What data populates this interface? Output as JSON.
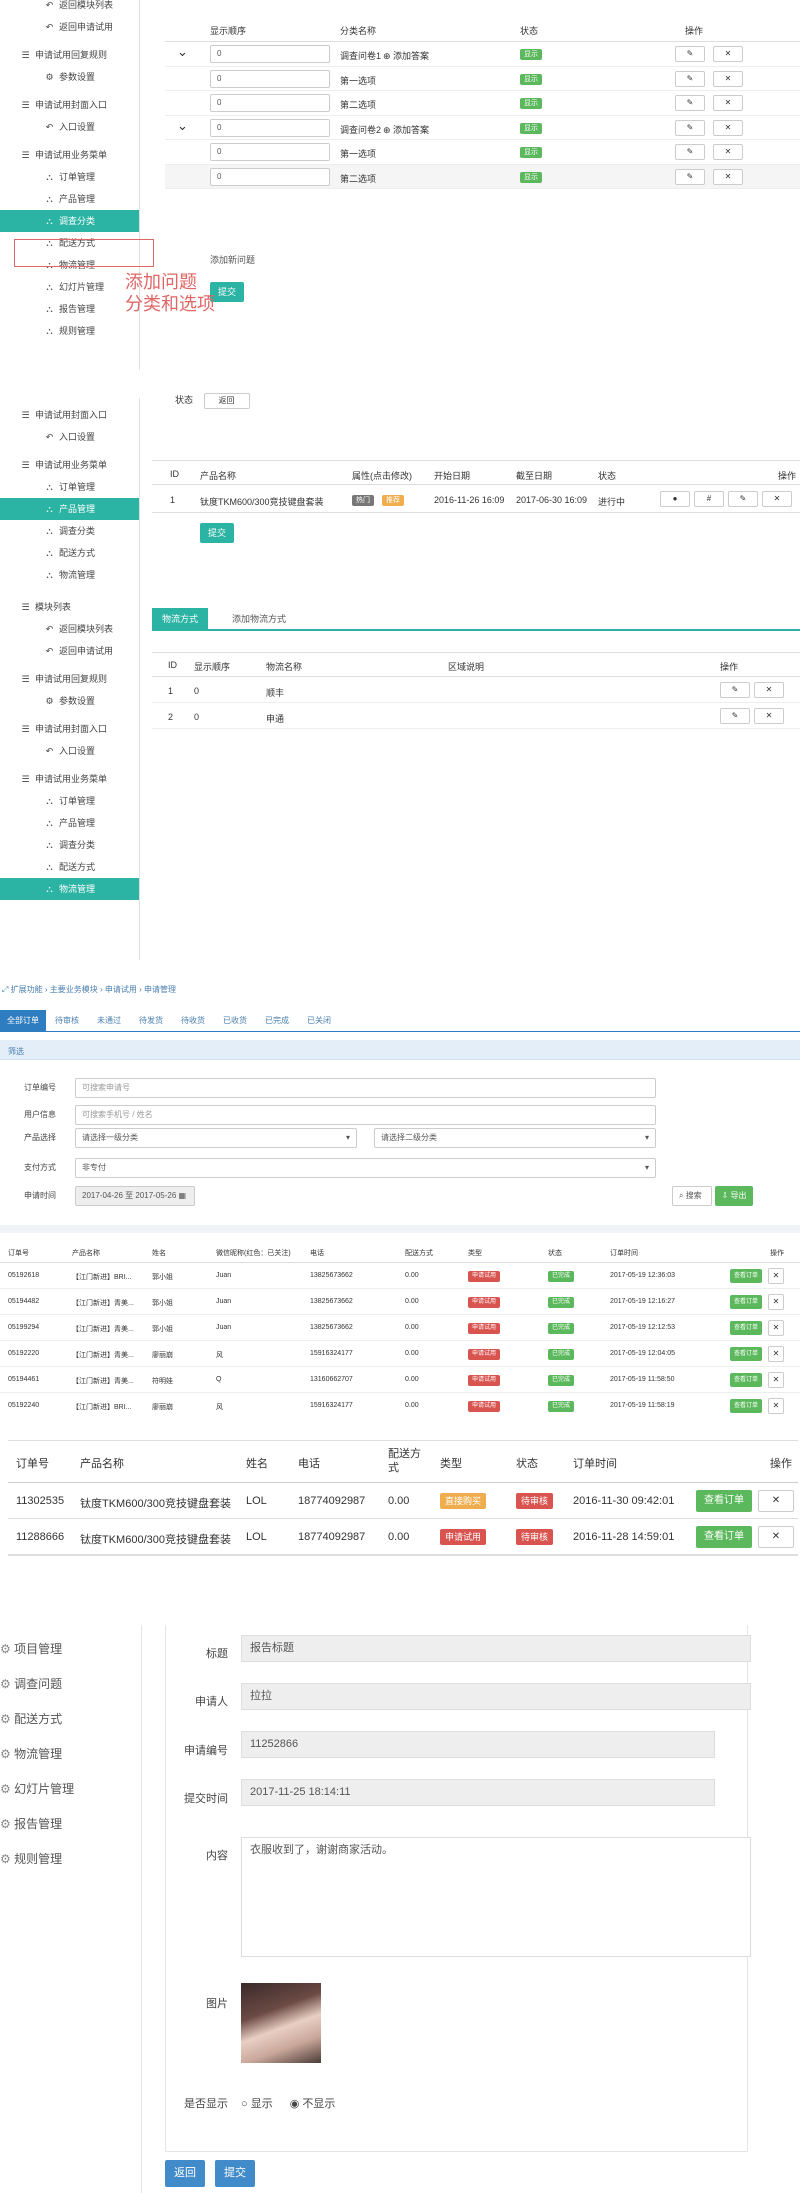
{
  "s1": {
    "sidebar": {
      "items": [
        {
          "label": "返回模块列表",
          "type": "it",
          "icon": "back-icon"
        },
        {
          "label": "返回申请试用",
          "type": "it",
          "icon": "back-icon"
        },
        {
          "label": "申请试用回复规则",
          "type": "gh",
          "icon": "list-icon"
        },
        {
          "label": "参数设置",
          "type": "it",
          "icon": "gear-icon"
        },
        {
          "label": "申请试用封面入口",
          "type": "gh",
          "icon": "list-icon"
        },
        {
          "label": "入口设置",
          "type": "it",
          "icon": "back-icon"
        },
        {
          "label": "申请试用业务菜单",
          "type": "gh",
          "icon": "list-icon"
        },
        {
          "label": "订单管理",
          "type": "it",
          "icon": "sitemap-icon"
        },
        {
          "label": "产品管理",
          "type": "it",
          "icon": "sitemap-icon"
        },
        {
          "label": "调查分类",
          "type": "it",
          "icon": "sitemap-icon",
          "active": true
        },
        {
          "label": "配送方式",
          "type": "it",
          "icon": "sitemap-icon"
        },
        {
          "label": "物流管理",
          "type": "it",
          "icon": "sitemap-icon"
        },
        {
          "label": "幻灯片管理",
          "type": "it",
          "icon": "sitemap-icon"
        },
        {
          "label": "报告管理",
          "type": "it",
          "icon": "sitemap-icon"
        },
        {
          "label": "规则管理",
          "type": "it",
          "icon": "sitemap-icon"
        }
      ]
    },
    "headers": [
      "显示顺序",
      "分类名称",
      "状态",
      "操作"
    ],
    "rows": [
      {
        "order": "0",
        "name": "调查问卷1",
        "add": "添加答案",
        "status": "显示",
        "expand": true
      },
      {
        "order": "0",
        "name": "第一选项",
        "status": "显示"
      },
      {
        "order": "0",
        "name": "第二选项",
        "status": "显示"
      },
      {
        "order": "0",
        "name": "调查问卷2",
        "add": "添加答案",
        "status": "显示",
        "expand": true
      },
      {
        "order": "0",
        "name": "第一选项",
        "status": "显示"
      },
      {
        "order": "0",
        "name": "第二选项",
        "status": "显示"
      }
    ],
    "add_question": "添加新问题",
    "submit": "提交",
    "annotation_line1": "添加问题",
    "annotation_line2": "分类和选项"
  },
  "s2": {
    "sidebar": [
      {
        "label": "申请试用封面入口",
        "type": "gh",
        "icon": "list-icon"
      },
      {
        "label": "入口设置",
        "type": "it",
        "icon": "back-icon"
      },
      {
        "label": "申请试用业务菜单",
        "type": "gh",
        "icon": "list-icon"
      },
      {
        "label": "订单管理",
        "type": "it",
        "icon": "sitemap-icon"
      },
      {
        "label": "产品管理",
        "type": "it",
        "icon": "sitemap-icon",
        "active": true
      },
      {
        "label": "调查分类",
        "type": "it",
        "icon": "sitemap-icon"
      },
      {
        "label": "配送方式",
        "type": "it",
        "icon": "sitemap-icon"
      },
      {
        "label": "物流管理",
        "type": "it",
        "icon": "sitemap-icon"
      }
    ],
    "top_label": "状态",
    "top_button": "返回",
    "headers": [
      "ID",
      "产品名称",
      "属性(点击修改)",
      "开始日期",
      "截至日期",
      "状态",
      "操作"
    ],
    "row": {
      "id": "1",
      "name": "钛度TKM600/300竞技键盘套装",
      "attr1": "热门",
      "attr2": "推荐",
      "start": "2016-11-26 16:09",
      "end": "2017-06-30 16:09",
      "status": "进行中"
    },
    "submit": "提交"
  },
  "s3": {
    "sidebar": [
      {
        "label": "模块列表",
        "type": "gh",
        "icon": "list-icon"
      },
      {
        "label": "返回模块列表",
        "type": "it",
        "icon": "back-icon"
      },
      {
        "label": "返回申请试用",
        "type": "it",
        "icon": "back-icon"
      },
      {
        "label": "申请试用回复规则",
        "type": "gh",
        "icon": "list-icon"
      },
      {
        "label": "参数设置",
        "type": "it",
        "icon": "gear-icon"
      },
      {
        "label": "申请试用封面入口",
        "type": "gh",
        "icon": "list-icon"
      },
      {
        "label": "入口设置",
        "type": "it",
        "icon": "back-icon"
      },
      {
        "label": "申请试用业务菜单",
        "type": "gh",
        "icon": "list-icon"
      },
      {
        "label": "订单管理",
        "type": "it",
        "icon": "sitemap-icon"
      },
      {
        "label": "产品管理",
        "type": "it",
        "icon": "sitemap-icon"
      },
      {
        "label": "调查分类",
        "type": "it",
        "icon": "sitemap-icon"
      },
      {
        "label": "配送方式",
        "type": "it",
        "icon": "sitemap-icon"
      },
      {
        "label": "物流管理",
        "type": "it",
        "icon": "sitemap-icon",
        "active": true
      }
    ],
    "tabs": [
      "物流方式",
      "添加物流方式"
    ],
    "headers": [
      "ID",
      "显示顺序",
      "物流名称",
      "区域说明",
      "操作"
    ],
    "rows": [
      {
        "id": "1",
        "order": "0",
        "name": "顺丰"
      },
      {
        "id": "2",
        "order": "0",
        "name": "申通"
      }
    ]
  },
  "s4": {
    "breadcrumb": "扩展功能 › 主要业务模块 › 申请试用 › 申请管理",
    "tabs": [
      "全部订单",
      "待审核",
      "未通过",
      "待发货",
      "待收货",
      "已收货",
      "已完成",
      "已关闭"
    ],
    "filter_title": "筛选",
    "fields": [
      {
        "label": "订单编号",
        "placeholder": "可搜索申请号"
      },
      {
        "label": "用户信息",
        "placeholder": "可搜索手机号 / 姓名"
      }
    ],
    "product_label": "产品选择",
    "product_sel1": "请选择一级分类",
    "product_sel2": "请选择二级分类",
    "pay_label": "支付方式",
    "pay_value": "非专付",
    "date_label": "申请时间",
    "date_value": "2017-04-26 至 2017-05-26",
    "search": "搜索",
    "export": "导出",
    "headers": [
      "订单号",
      "产品名称",
      "姓名",
      "微信昵称(红色：已关注)",
      "电话",
      "配送方式",
      "类型",
      "状态",
      "订单时间",
      "操作"
    ],
    "rows": [
      {
        "no": "05192618",
        "product": "【江门新进】BRI...",
        "name": "郭小姐",
        "nick": "Juan",
        "phone": "13825673662",
        "ship": "0.00",
        "type": "申请试用",
        "status": "已完成",
        "time": "2017-05-19 12:36:03"
      },
      {
        "no": "05194482",
        "product": "【江门新进】青美...",
        "name": "郭小姐",
        "nick": "Juan",
        "phone": "13825673662",
        "ship": "0.00",
        "type": "申请试用",
        "status": "已完成",
        "time": "2017-05-19 12:16:27"
      },
      {
        "no": "05199294",
        "product": "【江门新进】青美...",
        "name": "郭小姐",
        "nick": "Juan",
        "phone": "13825673662",
        "ship": "0.00",
        "type": "申请试用",
        "status": "已完成",
        "time": "2017-05-19 12:12:53"
      },
      {
        "no": "05192220",
        "product": "【江门新进】青美...",
        "name": "廖丽崩",
        "nick": "风",
        "phone": "15916324177",
        "ship": "0.00",
        "type": "申请试用",
        "status": "已完成",
        "time": "2017-05-19 12:04:05"
      },
      {
        "no": "05194461",
        "product": "【江门新进】青美...",
        "name": "符明娃",
        "nick": "Q",
        "phone": "13160662707",
        "ship": "0.00",
        "type": "申请试用",
        "status": "已完成",
        "time": "2017-05-19 11:58:50"
      },
      {
        "no": "05192240",
        "product": "【江门新进】BRI...",
        "name": "廖丽崩",
        "nick": "风",
        "phone": "15916324177",
        "ship": "0.00",
        "type": "申请试用",
        "status": "已完成",
        "time": "2017-05-19 11:58:19"
      }
    ],
    "view_btn": "查看订单"
  },
  "s5": {
    "headers": [
      "订单号",
      "产品名称",
      "姓名",
      "电话",
      "配送方式",
      "类型",
      "状态",
      "订单时间",
      "操作"
    ],
    "rows": [
      {
        "no": "11302535",
        "product": "钛度TKM600/300竞技键盘套装",
        "name": "LOL",
        "phone": "18774092987",
        "ship": "0.00",
        "type": "直接购买",
        "type_color": "#f0ad4e",
        "status": "待审核",
        "time": "2016-11-30 09:42:01"
      },
      {
        "no": "11288666",
        "product": "钛度TKM600/300竞技键盘套装",
        "name": "LOL",
        "phone": "18774092987",
        "ship": "0.00",
        "type": "申请试用",
        "type_color": "#d9534f",
        "status": "待审核",
        "time": "2016-11-28 14:59:01"
      }
    ],
    "view_btn": "查看订单"
  },
  "s6": {
    "sidebar": [
      "项目管理",
      "调查问题",
      "配送方式",
      "物流管理",
      "幻灯片管理",
      "报告管理",
      "规则管理"
    ],
    "title_label": "标题",
    "title_value": "报告标题",
    "applicant_label": "申请人",
    "applicant_value": "拉拉",
    "apply_no_label": "申请编号",
    "apply_no_value": "11252866",
    "time_label": "提交时间",
    "time_value": "2017-11-25 18:14:11",
    "content_label": "内容",
    "content_value": "衣服收到了，谢谢商家活动。",
    "image_label": "图片",
    "show_label": "是否显示",
    "show_yes": "显示",
    "show_no": "不显示",
    "back": "返回",
    "submit": "提交"
  }
}
